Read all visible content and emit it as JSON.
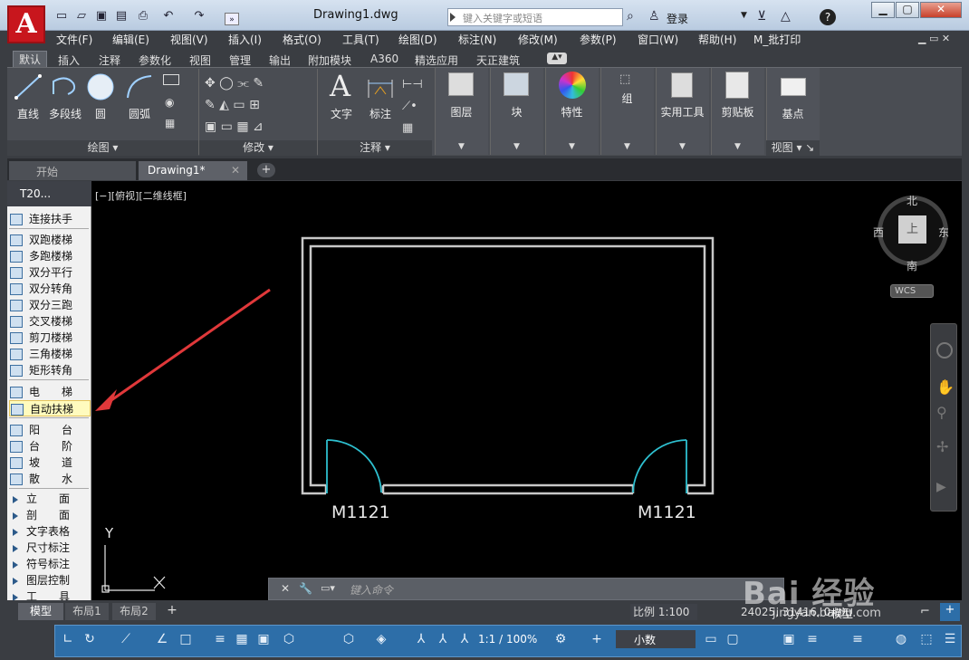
{
  "app": {
    "logo": "A",
    "title": "Drawing1.dwg",
    "search_placeholder": "键入关键字或短语",
    "login": "登录"
  },
  "menu": [
    "文件(F)",
    "编辑(E)",
    "视图(V)",
    "插入(I)",
    "格式(O)",
    "工具(T)",
    "绘图(D)",
    "标注(N)",
    "修改(M)",
    "参数(P)",
    "窗口(W)",
    "帮助(H)",
    "M_批打印"
  ],
  "ribbon_tabs": [
    "默认",
    "插入",
    "注释",
    "参数化",
    "视图",
    "管理",
    "输出",
    "附加模块",
    "A360",
    "精选应用",
    "天正建筑"
  ],
  "ribbon": {
    "draw_tools": [
      "直线",
      "多段线",
      "圆",
      "圆弧"
    ],
    "draw_panel": "绘图",
    "modify_panel": "修改",
    "annot_tools": [
      "文字",
      "标注"
    ],
    "annot_panel": "注释",
    "big": [
      "图层",
      "块",
      "特性",
      "组",
      "实用工具",
      "剪贴板",
      "基点"
    ],
    "view_panel": "视图"
  },
  "doc_tabs": [
    "开始",
    "Drawing1*"
  ],
  "left_panel": {
    "header": "T20...",
    "items": [
      "连接扶手",
      "双跑楼梯",
      "多跑楼梯",
      "双分平行",
      "双分转角",
      "双分三跑",
      "交叉楼梯",
      "剪刀楼梯",
      "三角楼梯",
      "矩形转角",
      "电　　梯",
      "自动扶梯",
      "阳　　台",
      "台　　阶",
      "坡　　道",
      "散　　水",
      "立　　面",
      "剖　　面",
      "文字表格",
      "尺寸标注",
      "符号标注",
      "图层控制",
      "工　　具"
    ]
  },
  "viewport": {
    "label": "[−][俯视][二维线框]",
    "door_left": "M1121",
    "door_right": "M1121",
    "axis_y": "Y",
    "compass": {
      "n": "北",
      "s": "南",
      "e": "东",
      "w": "西",
      "center": "上",
      "wcs": "WCS"
    }
  },
  "cmd": {
    "placeholder": "键入命令"
  },
  "layout_tabs": [
    "模型",
    "布局1",
    "布局2"
  ],
  "status": {
    "scale": "比例 1:100",
    "coords": "24025, 31416, 0",
    "model": "模型",
    "anno_scale": "1:1 / 100%",
    "units": "小数"
  },
  "watermark": {
    "brand": "Bai 经验",
    "url": "jingyan.baidu.com"
  },
  "colors": {
    "accent_red": "#e0383a",
    "door_cyan": "#2ec0d0",
    "wall": "#c8c8c8",
    "bottom_blue": "#2d6ea8"
  }
}
